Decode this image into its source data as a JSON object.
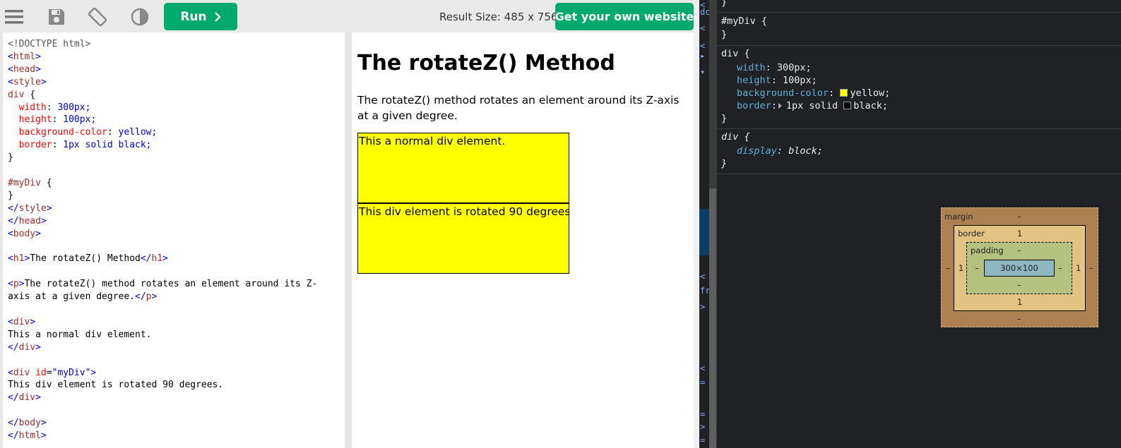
{
  "toolbar": {
    "icons": [
      "menu-icon",
      "save-icon",
      "rotate-icon",
      "contrast-icon"
    ],
    "run_label": "Run",
    "result_size": "Result Size: 485 x 756",
    "get_website_label": "Get your own website",
    "accent_color": "#04aa6d"
  },
  "code": {
    "lines": [
      "<!DOCTYPE html>",
      "<html>",
      "<head>",
      "<style>",
      "div {",
      "  width: 300px;",
      "  height: 100px;",
      "  background-color: yellow;",
      "  border: 1px solid black;",
      "}",
      "",
      "#myDiv {",
      "}",
      "</style>",
      "</head>",
      "<body>",
      "",
      "<h1>The rotateZ() Method</h1>",
      "",
      "<p>The rotateZ() method rotates an element around its Z-",
      "axis at a given degree.</p>",
      "",
      "<div>",
      "This a normal div element.",
      "</div>",
      "",
      "<div id=\"myDiv\">",
      "This div element is rotated 90 degrees.",
      "</div>",
      "",
      "</body>",
      "</html>"
    ]
  },
  "result": {
    "heading": "The rotateZ() Method",
    "paragraph": "The rotateZ() method rotates an element around its Z-axis at a given degree.",
    "div1_text": "This a normal div element.",
    "div2_text": "This div element is rotated 90 degrees."
  },
  "devtools": {
    "left_glyphs": [
      "<",
      "dc",
      "<",
      "<",
      "▸",
      "▾",
      "<",
      "fr",
      ">",
      "<",
      "=",
      "=",
      ">",
      "="
    ],
    "rules": {
      "top_brace": "}",
      "mydiv_selector": "#myDiv {",
      "mydiv_close": "}",
      "div_selector": "div {",
      "div_props": [
        {
          "name": "width",
          "value": "300px;"
        },
        {
          "name": "height",
          "value": "100px;"
        },
        {
          "name": "background-color",
          "value": "yellow;",
          "swatch": "#ffff00"
        },
        {
          "name": "border",
          "value": "1px solid ",
          "value2": "black;",
          "swatch": "#000000"
        }
      ],
      "div_close": "}",
      "ua_selector": "div {",
      "ua_prop": {
        "name": "display",
        "value": "block;"
      },
      "ua_close": "}"
    },
    "box_model": {
      "margin_label": "margin",
      "margin_top": "–",
      "margin_bottom": "–",
      "margin_left": "–",
      "margin_right": "–",
      "border_label": "border",
      "border_top": "1",
      "border_bottom": "1",
      "border_left": "1",
      "border_right": "1",
      "padding_label": "padding",
      "padding_top": "–",
      "padding_bottom": "–",
      "padding_left": "–",
      "padding_right": "–",
      "content": "300×100"
    }
  }
}
